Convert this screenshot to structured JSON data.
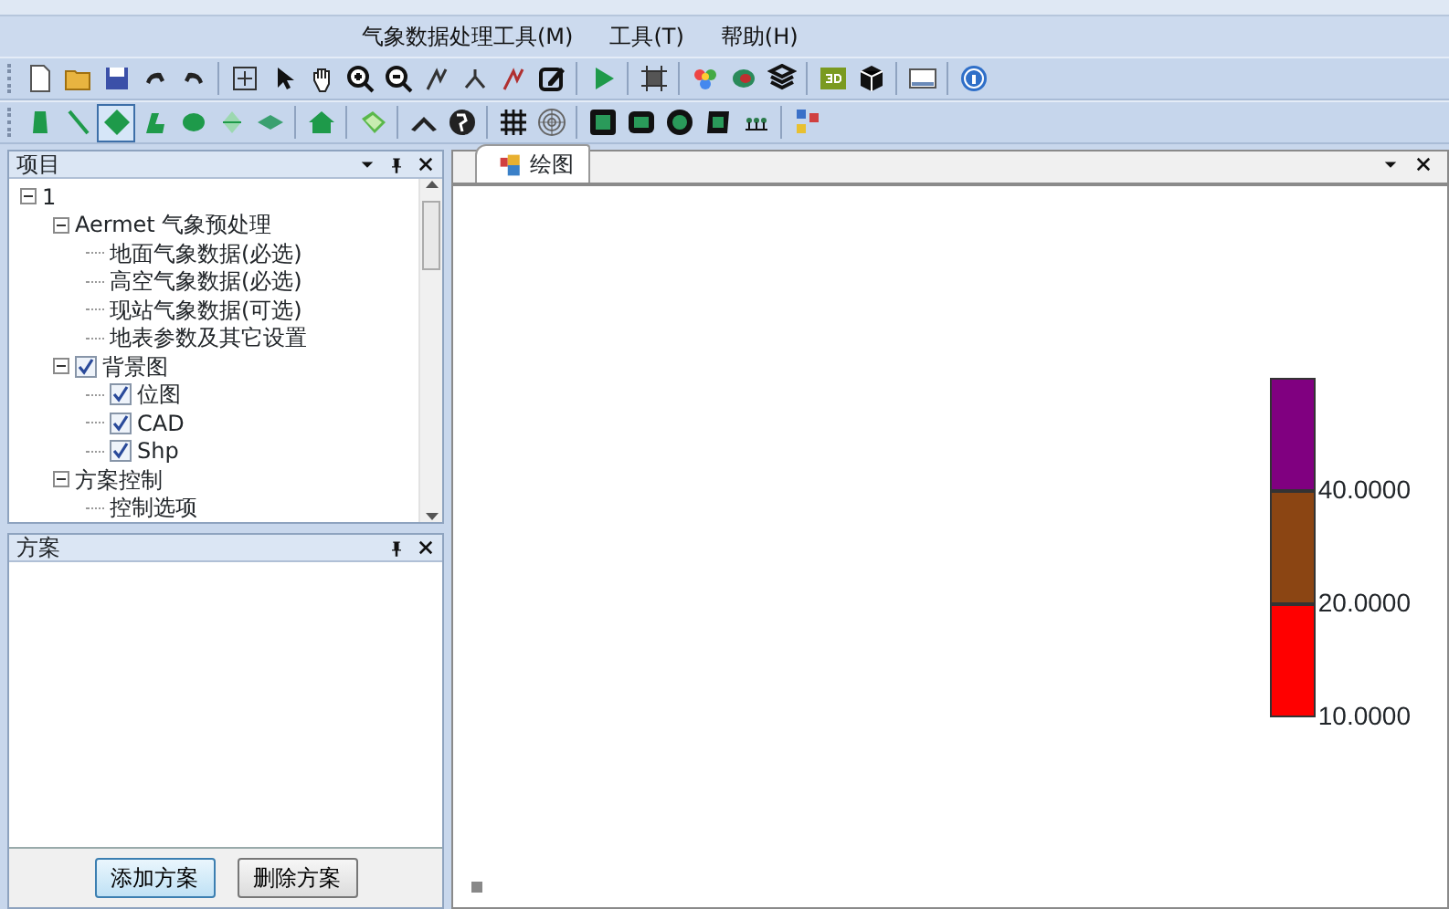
{
  "menu": [
    {
      "label": "气象数据处理工具(M)"
    },
    {
      "label": "工具(T)"
    },
    {
      "label": "帮助(H)"
    }
  ],
  "toolbars": [
    {
      "groups": [
        {
          "buttons": [
            {
              "selected": false
            },
            {
              "selected": false
            },
            {
              "selected": false
            },
            {
              "selected": false
            },
            {
              "selected": false
            }
          ]
        },
        {
          "buttons": [
            {
              "selected": false
            },
            {
              "selected": false
            },
            {
              "selected": false
            },
            {
              "selected": false
            },
            {
              "selected": false
            },
            {
              "selected": false
            },
            {
              "selected": false
            },
            {
              "selected": false
            },
            {
              "selected": false
            }
          ]
        },
        {
          "buttons": [
            {
              "selected": false
            }
          ]
        },
        {
          "buttons": [
            {
              "selected": false
            }
          ]
        },
        {
          "buttons": [
            {
              "selected": false
            },
            {
              "selected": false
            },
            {
              "selected": false
            }
          ]
        },
        {
          "buttons": [
            {
              "selected": false
            },
            {
              "selected": false
            }
          ]
        },
        {
          "buttons": [
            {
              "selected": false
            }
          ]
        },
        {
          "buttons": [
            {
              "selected": false
            }
          ]
        }
      ]
    },
    {
      "groups": [
        {
          "buttons": [
            {
              "selected": false
            },
            {
              "selected": false
            },
            {
              "selected": true
            },
            {
              "selected": false
            },
            {
              "selected": false
            },
            {
              "selected": false
            },
            {
              "selected": false
            }
          ]
        },
        {
          "buttons": [
            {
              "selected": false
            }
          ]
        },
        {
          "buttons": [
            {
              "selected": false
            }
          ]
        },
        {
          "buttons": [
            {
              "selected": false
            },
            {
              "selected": false
            }
          ]
        },
        {
          "buttons": [
            {
              "selected": false
            },
            {
              "selected": false
            }
          ]
        },
        {
          "buttons": [
            {
              "selected": false
            },
            {
              "selected": false
            },
            {
              "selected": false
            },
            {
              "selected": false
            },
            {
              "selected": false
            }
          ]
        },
        {
          "buttons": [
            {
              "selected": false
            }
          ]
        }
      ]
    }
  ],
  "project_panel": {
    "title": "项目",
    "tree": [
      {
        "label": "1",
        "expanded": true,
        "children": [
          {
            "label": "Aermet 气象预处理",
            "expanded": true,
            "children": [
              {
                "label": "地面气象数据(必选)"
              },
              {
                "label": "高空气象数据(必选)"
              },
              {
                "label": "现站气象数据(可选)"
              },
              {
                "label": "地表参数及其它设置"
              }
            ]
          },
          {
            "label": "背景图",
            "expanded": true,
            "checked": true,
            "children": [
              {
                "label": "位图",
                "checked": true
              },
              {
                "label": "CAD",
                "checked": true
              },
              {
                "label": "Shp",
                "checked": true
              }
            ]
          },
          {
            "label": "方案控制",
            "expanded": true,
            "children": [
              {
                "label": "控制选项"
              }
            ]
          }
        ]
      }
    ]
  },
  "scheme_panel": {
    "title": "方案",
    "buttons": [
      {
        "label": "添加方案",
        "selected": true
      },
      {
        "label": "删除方案",
        "selected": false
      }
    ]
  },
  "document_tabs": [
    {
      "label": "绘图",
      "selected": true
    }
  ],
  "legend": [
    {
      "color": "#800080",
      "label": "40.0000"
    },
    {
      "color": "#8b4513",
      "label": "20.0000"
    },
    {
      "color": "#ff0000",
      "label": "10.0000"
    }
  ]
}
